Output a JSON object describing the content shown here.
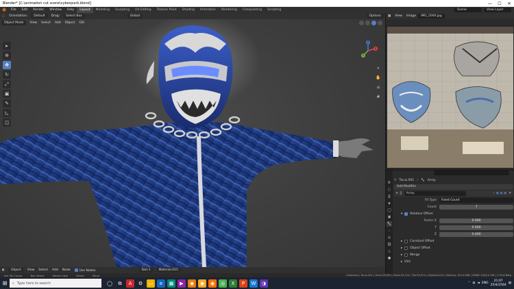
{
  "window": {
    "title": "Blender* [C:\\animation cut scene\\cyberpunk.blend]",
    "minimize": "—",
    "maximize": "☐",
    "close": "✕"
  },
  "topbar": {
    "menus": [
      "File",
      "Edit",
      "Render",
      "Window",
      "Help"
    ],
    "workspaces": [
      "Layout",
      "Modeling",
      "Sculpting",
      "UV Editing",
      "Texture Paint",
      "Shading",
      "Animation",
      "Rendering",
      "Compositing",
      "Scripting"
    ],
    "active_workspace": "Layout",
    "scene_label": "Scene",
    "view_layer_label": "View Layer"
  },
  "viewport": {
    "header": {
      "orientation_label": "Orientation:",
      "orientation_value": "Default",
      "drag_label": "Drag:",
      "drag_value": "Select Box",
      "transform_global": "Global",
      "options": "Options"
    },
    "header2": {
      "mode": "Object Mode",
      "menus": [
        "View",
        "Select",
        "Add",
        "Object",
        "GIS"
      ]
    },
    "gizmo": {
      "x": "X",
      "y": "Y",
      "z": "Z"
    },
    "footer": {
      "object": "Object",
      "menus": [
        "View",
        "Select",
        "Add",
        "Node"
      ],
      "use_nodes": "Use Nodes",
      "slot": "Slot 1",
      "material": "Material.015"
    }
  },
  "statusbar": {
    "items": [
      "Set 3D Cursor",
      "Box Select",
      "Rotate View",
      "Select",
      "Move"
    ],
    "stats": "Collection | Torus.001 | Verts:25,855 | Faces:25,514 | Tris:50,974 | Objects:0/13 | Memory: 321.8 MiB | VRAM: 0.8/4.0 GiB | 2.93.6 Beta"
  },
  "image_editor": {
    "view": "View",
    "image_menu": "Image",
    "image_name": "IMG_5000.jpg"
  },
  "properties": {
    "breadcrumb_object": "Torus.001",
    "breadcrumb_modifier": "Array",
    "add_modifier": "Add Modifier",
    "modifier_name": "Array",
    "fit_type_label": "Fit Type",
    "fit_type_value": "Fixed Count",
    "count_label": "Count",
    "count_value": "7",
    "relative_offset": "Relative Offset",
    "factor_x_label": "Factor X",
    "factor_x": "0.000",
    "y_label": "Y",
    "factor_y": "0.000",
    "z_label": "Z",
    "factor_z": "0.000",
    "constant_offset": "Constant Offset",
    "object_offset": "Object Offset",
    "merge": "Merge",
    "uvs": "UVs"
  },
  "taskbar": {
    "search_placeholder": "Type here to search",
    "language": "ENG",
    "time": "21:07",
    "date": "25/4/2564"
  },
  "colors": {
    "accent": "#5680c2",
    "blender_orange": "#e87d0d",
    "suit_blue": "#1f3f8a"
  }
}
